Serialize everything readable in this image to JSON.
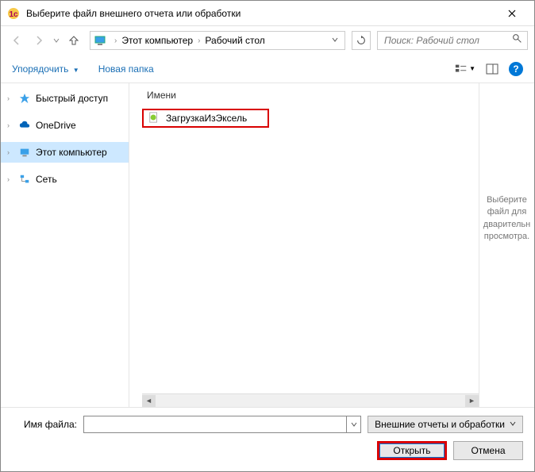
{
  "titlebar": {
    "title": "Выберите файл внешнего отчета или обработки"
  },
  "breadcrumb": {
    "item1": "Этот компьютер",
    "item2": "Рабочий стол"
  },
  "search": {
    "placeholder": "Поиск: Рабочий стол"
  },
  "toolbar": {
    "organize": "Упорядочить",
    "newfolder": "Новая папка"
  },
  "sidebar": {
    "quickaccess": "Быстрый доступ",
    "onedrive": "OneDrive",
    "thispc": "Этот компьютер",
    "network": "Сеть"
  },
  "filelist": {
    "header": "Имени",
    "file1": "ЗагрузкаИзЭксель"
  },
  "preview": {
    "text": "Выберите файл для дварительн просмотра."
  },
  "footer": {
    "filename_label": "Имя файла:",
    "filter": "Внешние отчеты и обработки",
    "open": "Открыть",
    "cancel": "Отмена"
  }
}
